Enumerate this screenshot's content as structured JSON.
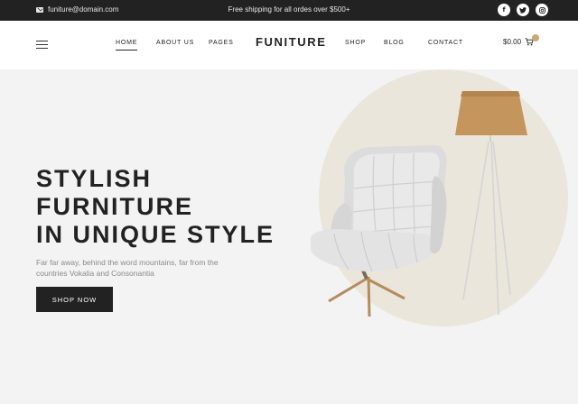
{
  "topbar": {
    "email": "funiture@domain.com",
    "shipping": "Free shipping for all ordes over $500+",
    "email_icon": "envelope-icon",
    "socials": [
      {
        "icon": "facebook-icon",
        "glyph": "f"
      },
      {
        "icon": "twitter-icon",
        "glyph": "t"
      },
      {
        "icon": "instagram-icon",
        "glyph": "◎"
      }
    ]
  },
  "header": {
    "logo": "FUNITURE",
    "nav": {
      "home": "HOME",
      "about": "ABOUT US",
      "pages": "PAGES",
      "shop": "SHOP",
      "blog": "BLOG",
      "contact": "CONTACT"
    },
    "cart_total": "$0.00",
    "menu_icon": "hamburger-menu-icon",
    "cart_icon": "shopping-cart-icon"
  },
  "hero": {
    "title_lines": [
      "STYLISH",
      "FURNITURE",
      "IN UNIQUE STYLE"
    ],
    "text": "Far far away, behind the word mountains, far from the countries Vokalia and Consonantia",
    "button": "SHOP NOW"
  },
  "colors": {
    "topbar_bg": "#222222",
    "accent": "#c9a877",
    "circle": "#ebe6dc",
    "lamp_shade": "#c4955c",
    "button_bg": "#222222"
  }
}
